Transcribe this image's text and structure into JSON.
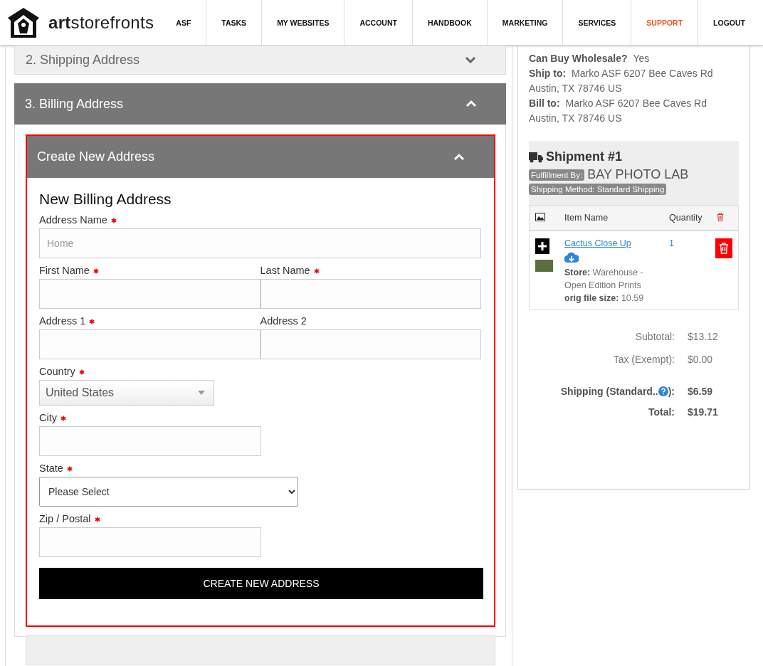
{
  "header": {
    "logo_bold": "art",
    "logo_rest": "storefronts",
    "nav": [
      {
        "label": "ASF",
        "selected": false
      },
      {
        "label": "TASKS",
        "selected": false
      },
      {
        "label": "MY WEBSITES",
        "selected": false
      },
      {
        "label": "ACCOUNT",
        "selected": false
      },
      {
        "label": "HANDBOOK",
        "selected": false
      },
      {
        "label": "MARKETING",
        "selected": false
      },
      {
        "label": "SERVICES",
        "selected": false
      },
      {
        "label": "SUPPORT",
        "selected": true
      },
      {
        "label": "LOGOUT",
        "selected": false
      }
    ]
  },
  "shipping_panel": {
    "title": "2. Shipping Address",
    "expanded": false
  },
  "billing_panel": {
    "title": "3. Billing Address",
    "expanded": true
  },
  "create_panel": {
    "title": "Create New Address",
    "expanded": true,
    "heading": "New Billing Address",
    "rows": [
      [
        {
          "kind": "text",
          "label": "Address Name",
          "required": true,
          "placeholder": "Home",
          "wide": true
        }
      ],
      [
        {
          "kind": "text",
          "label": "First Name",
          "required": true
        },
        {
          "kind": "text",
          "label": "Last Name",
          "required": true
        }
      ],
      [
        {
          "kind": "text",
          "label": "Address 1",
          "required": true
        },
        {
          "kind": "text",
          "label": "Address 2",
          "required": false
        }
      ],
      [
        {
          "kind": "dropdown",
          "label": "Country",
          "required": true,
          "value": "United States"
        }
      ],
      [
        {
          "kind": "text",
          "label": "City",
          "required": true
        }
      ],
      [
        {
          "kind": "select",
          "label": "State",
          "required": true,
          "value": "Please Select"
        }
      ],
      [
        {
          "kind": "text",
          "label": "Zip / Postal",
          "required": true
        }
      ]
    ],
    "button": "CREATE NEW ADDRESS"
  },
  "order": {
    "details": [
      {
        "label": "Can Buy Wholesale?",
        "value": "Yes"
      },
      {
        "label": "Ship to:",
        "value": "Marko ASF 6207 Bee Caves Rd Austin, TX 78746 US"
      },
      {
        "label": "Bill to:",
        "value": "Marko ASF 6207 Bee Caves Rd Austin, TX 78746 US"
      }
    ],
    "shipment": {
      "title": "Shipment #1",
      "fulfillment_label": "Fulfillment By:",
      "fulfillment_value": "BAY PHOTO LAB",
      "method": "Shipping Method: Standard Shipping",
      "columns": [
        "Item Name",
        "Quantity"
      ],
      "items": [
        {
          "name": "Cactus Close Up",
          "quantity": "1",
          "store_label": "Store:",
          "store_value": "Warehouse - Open Edition Prints",
          "size_label": "orig file size:",
          "size_value": "10.59"
        }
      ]
    },
    "totals": [
      {
        "kind": "plain",
        "label": "Subtotal:",
        "value": "$13.12"
      },
      {
        "kind": "plain",
        "label": "Tax (Exempt):",
        "value": "$0.00"
      },
      {
        "kind": "help",
        "label": "Shipping (Standard..",
        "label_end": "):",
        "value": "$6.59"
      },
      {
        "kind": "bold",
        "label": "Total:",
        "value": "$19.71"
      }
    ]
  }
}
